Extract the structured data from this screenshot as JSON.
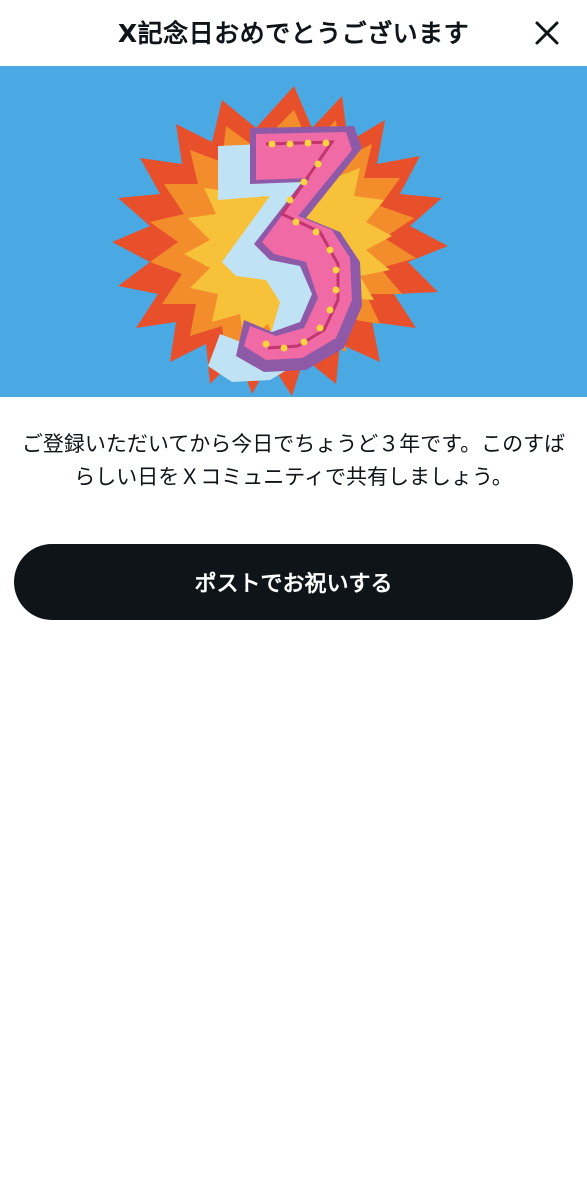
{
  "header": {
    "title": "X記念日おめでとうございます",
    "close_icon": "close-icon"
  },
  "banner": {
    "image": "anniversary-3-years-illustration",
    "number": "3",
    "background_color": "#4aa9e2"
  },
  "message": {
    "line1": "ご登録いただいてから今日でちょうど３年です。このすば",
    "line2": "らしい日をＸコミュニティで共有しましょう。"
  },
  "actions": {
    "post_label": "ポストでお祝いする"
  },
  "colors": {
    "primary_button": "#0f1419",
    "text": "#0f1419"
  }
}
